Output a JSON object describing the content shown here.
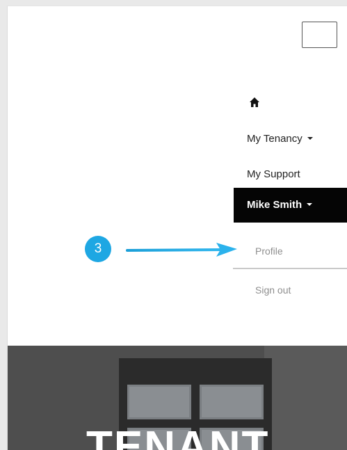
{
  "navbar": {
    "toggle_icon": "hamburger-icon",
    "home_icon": "home-icon",
    "items": [
      {
        "label": "My Tenancy",
        "has_caret": true
      },
      {
        "label": "My Support",
        "has_caret": false
      },
      {
        "label": "Mike Smith",
        "has_caret": true,
        "active": true
      }
    ]
  },
  "user_dropdown": {
    "items": [
      {
        "label": "Profile"
      },
      {
        "label": "Sign out"
      }
    ]
  },
  "annotation": {
    "step_number": "3",
    "color": "#1ea7e3"
  },
  "hero": {
    "title": "TENANT"
  },
  "colors": {
    "active_bg": "#050505",
    "dropdown_text": "#8e8e8e",
    "callout": "#1ea7e3"
  }
}
